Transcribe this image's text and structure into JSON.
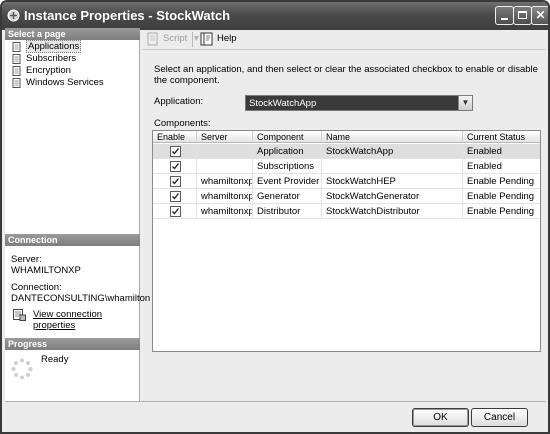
{
  "window": {
    "title": "Instance Properties - StockWatch"
  },
  "left_pane": {
    "select_page_header": "Select a page",
    "nav_items": [
      {
        "label": "Applications",
        "icon": "page-icon",
        "selected": true
      },
      {
        "label": "Subscribers",
        "icon": "page-icon",
        "selected": false
      },
      {
        "label": "Encryption",
        "icon": "page-icon",
        "selected": false
      },
      {
        "label": "Windows Services",
        "icon": "page-icon",
        "selected": false
      }
    ],
    "connection_header": "Connection",
    "server_label": "Server:",
    "server_value": "WHAMILTONXP",
    "connection_label": "Connection:",
    "connection_value": "DANTECONSULTING\\whamilton",
    "view_connection_link": "View connection properties",
    "progress_header": "Progress",
    "progress_status": "Ready"
  },
  "toolbar": {
    "script_label": "Script",
    "help_label": "Help"
  },
  "main": {
    "instruction": "Select an application, and then select or clear the associated checkbox to enable or disable the component.",
    "application_label": "Application:",
    "application_value": "StockWatchApp",
    "components_label": "Components:",
    "columns": [
      "Enable",
      "Server",
      "Component",
      "Name",
      "Current Status"
    ],
    "rows": [
      {
        "enabled": true,
        "server": "",
        "component": "Application",
        "name": "StockWatchApp",
        "status": "Enabled",
        "selected": true
      },
      {
        "enabled": true,
        "server": "",
        "component": "Subscriptions",
        "name": "",
        "status": "Enabled",
        "selected": false
      },
      {
        "enabled": true,
        "server": "whamiltonxp",
        "component": "Event Provider",
        "name": "StockWatchHEP",
        "status": "Enable Pending",
        "selected": false
      },
      {
        "enabled": true,
        "server": "whamiltonxp",
        "component": "Generator",
        "name": "StockWatchGenerator",
        "status": "Enable Pending",
        "selected": false
      },
      {
        "enabled": true,
        "server": "whamiltonxp",
        "component": "Distributor",
        "name": "StockWatchDistributor",
        "status": "Enable Pending",
        "selected": false
      }
    ]
  },
  "buttons": {
    "ok": "OK",
    "cancel": "Cancel"
  }
}
